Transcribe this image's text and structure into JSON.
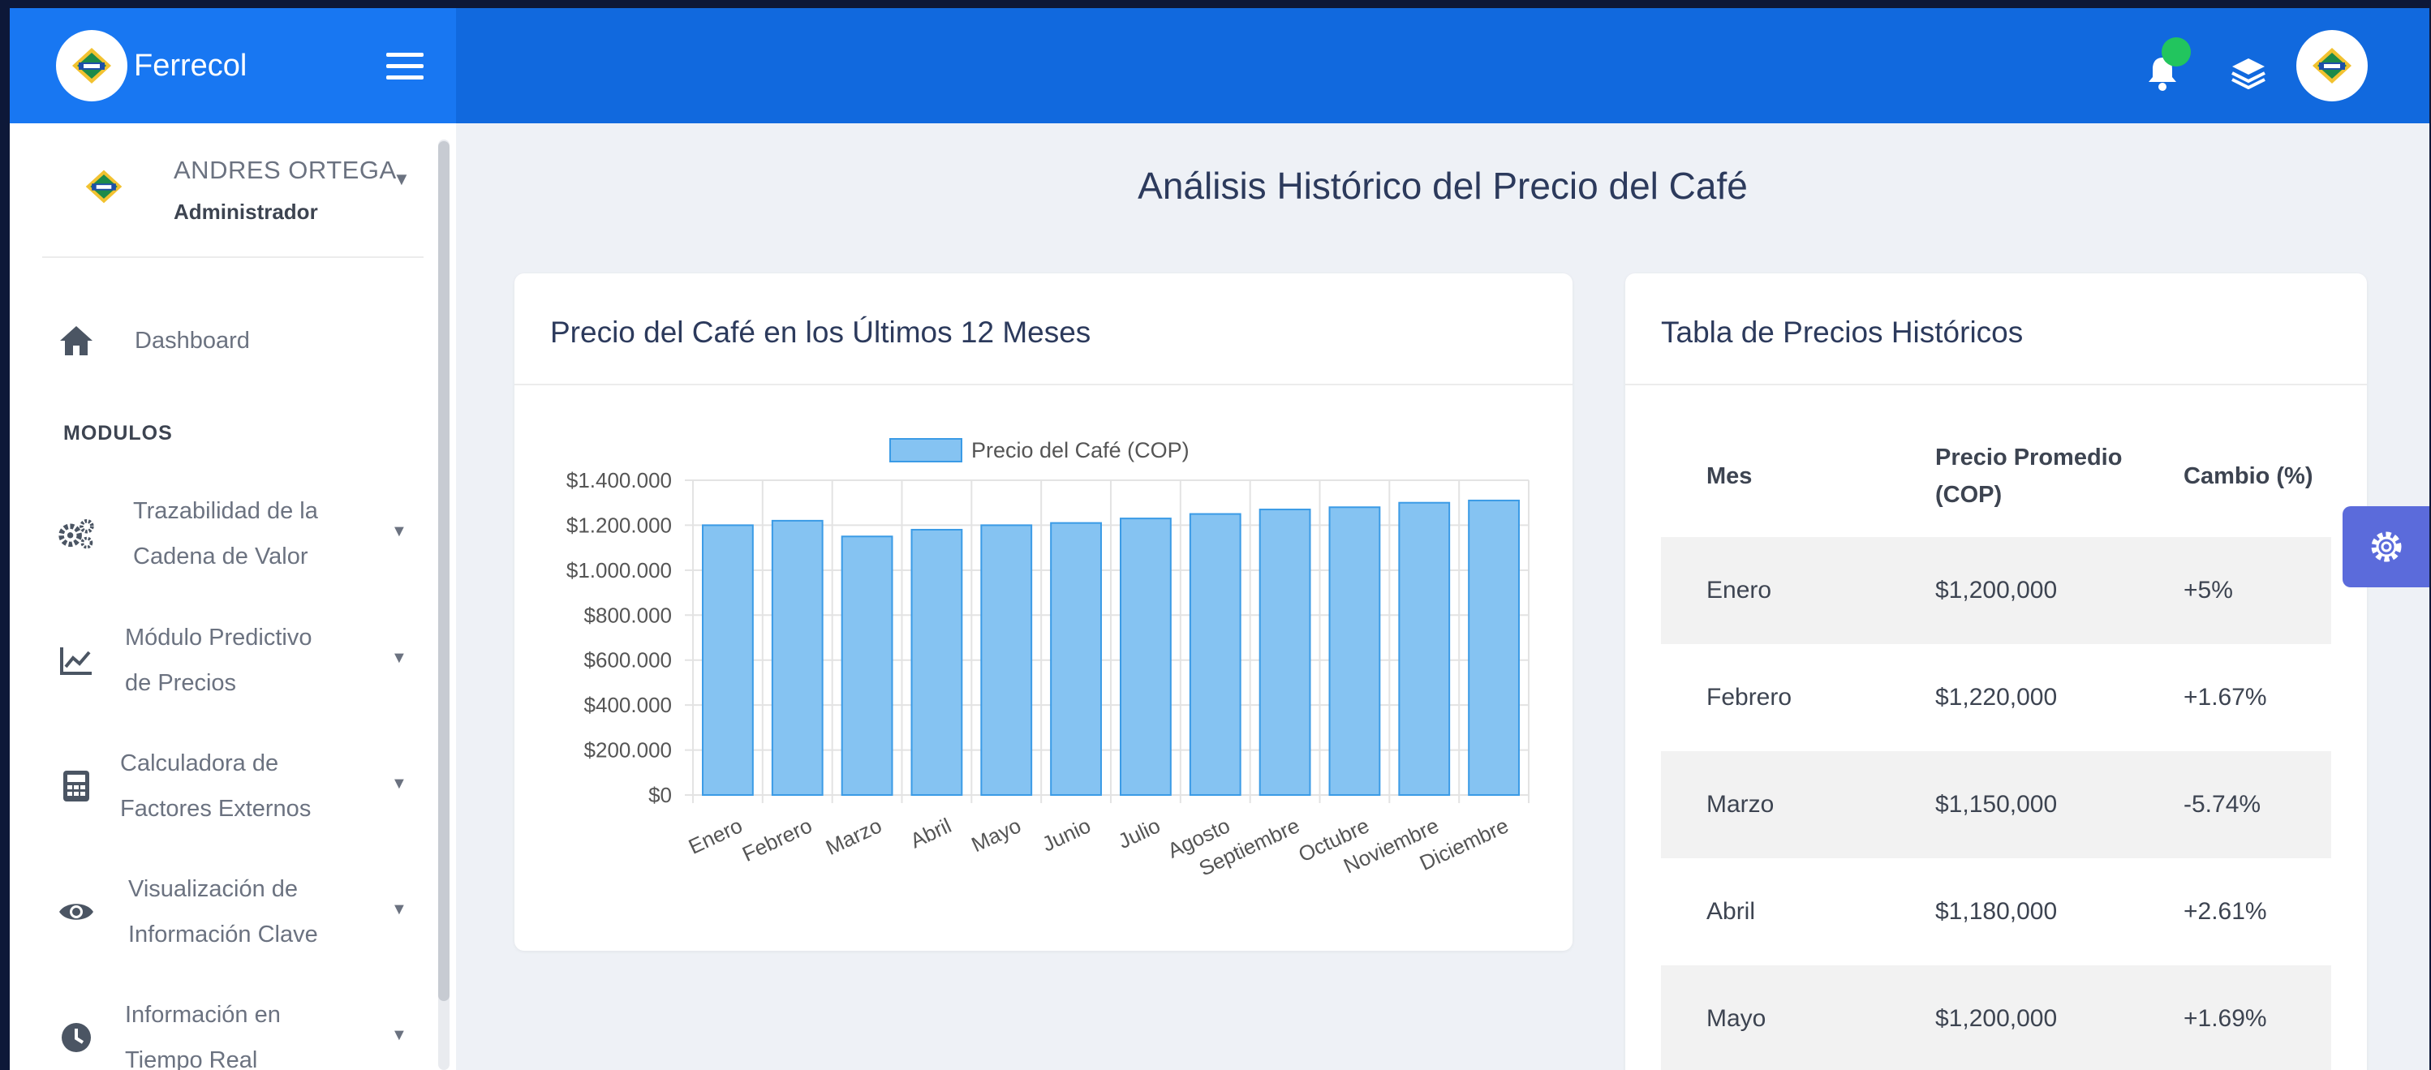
{
  "app": {
    "brand_name": "Ferrecol"
  },
  "topbar": {
    "icons": [
      "bell-icon",
      "layers-icon",
      "avatar"
    ],
    "notification_color": "#22c55e",
    "accent": "#1877f2"
  },
  "user": {
    "name": "ANDRES ORTEGA",
    "role": "Administrador"
  },
  "sidebar": {
    "dashboard_label": "Dashboard",
    "section_title": "MODULOS",
    "items": [
      {
        "line1": "Trazabilidad de la",
        "line2": "Cadena de Valor",
        "icon": "cogs-icon"
      },
      {
        "line1": "Módulo Predictivo",
        "line2": "de Precios",
        "icon": "trend-chart-icon"
      },
      {
        "line1": "Calculadora de",
        "line2": "Factores Externos",
        "icon": "calculator-icon"
      },
      {
        "line1": "Visualización de",
        "line2": "Información Clave",
        "icon": "eye-icon"
      },
      {
        "line1": "Información en",
        "line2": "Tiempo Real",
        "icon": "clock-icon"
      }
    ]
  },
  "main": {
    "page_title": "Análisis Histórico del Precio del Café",
    "chart_card_title": "Precio del Café en los Últimos 12 Meses",
    "table_card_title": "Tabla de Precios Históricos"
  },
  "chart_data": {
    "type": "bar",
    "categories": [
      "Enero",
      "Febrero",
      "Marzo",
      "Abril",
      "Mayo",
      "Junio",
      "Julio",
      "Agosto",
      "Septiembre",
      "Octubre",
      "Noviembre",
      "Diciembre"
    ],
    "series": [
      {
        "name": "Precio del Café (COP)",
        "values": [
          1200000,
          1220000,
          1150000,
          1180000,
          1200000,
          1210000,
          1230000,
          1250000,
          1270000,
          1280000,
          1300000,
          1310000
        ]
      }
    ],
    "y_ticks": [
      "$0",
      "$200.000",
      "$400.000",
      "$600.000",
      "$800.000",
      "$1.000.000",
      "$1.200.000",
      "$1.400.000"
    ],
    "ylim": [
      0,
      1400000
    ],
    "legend_position": "top",
    "grid": true,
    "bar_color": "#85c3f2",
    "bar_border": "#3b9be6"
  },
  "table": {
    "headers": [
      "Mes",
      "Precio Promedio (COP)",
      "Cambio (%)"
    ],
    "rows": [
      {
        "month": "Enero",
        "price": "$1,200,000",
        "change": "+5%"
      },
      {
        "month": "Febrero",
        "price": "$1,220,000",
        "change": "+1.67%"
      },
      {
        "month": "Marzo",
        "price": "$1,150,000",
        "change": "-5.74%"
      },
      {
        "month": "Abril",
        "price": "$1,180,000",
        "change": "+2.61%"
      },
      {
        "month": "Mayo",
        "price": "$1,200,000",
        "change": "+1.69%"
      }
    ]
  }
}
